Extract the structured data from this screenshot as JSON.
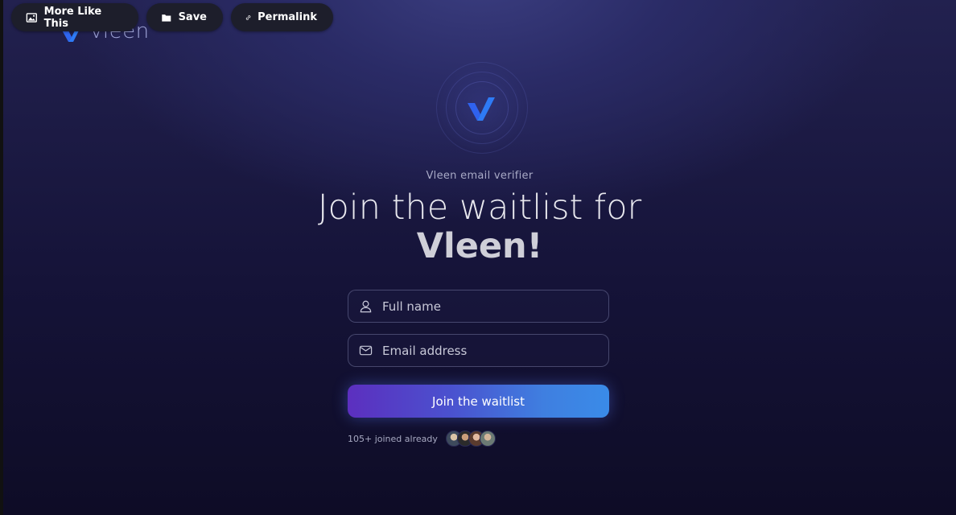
{
  "brand": {
    "name": "vleen"
  },
  "toolbar": {
    "more_like_this": "More Like This",
    "save": "Save",
    "permalink": "Permalink"
  },
  "hero": {
    "subtitle": "Vleen email verifier",
    "headline_line1": "Join the waitlist for",
    "headline_line2": "Vleen!"
  },
  "form": {
    "full_name_placeholder": "Full name",
    "email_placeholder": "Email address",
    "submit_label": "Join the waitlist"
  },
  "social_proof": {
    "joined_text": "105+ joined already",
    "avatars": [
      "avatar-1",
      "avatar-2",
      "avatar-3",
      "avatar-4"
    ]
  },
  "colors": {
    "accent_blue": "#2e7bf6",
    "button_gradient_start": "#5c2fbf",
    "button_gradient_end": "#3a8be8",
    "background": "#151338"
  }
}
